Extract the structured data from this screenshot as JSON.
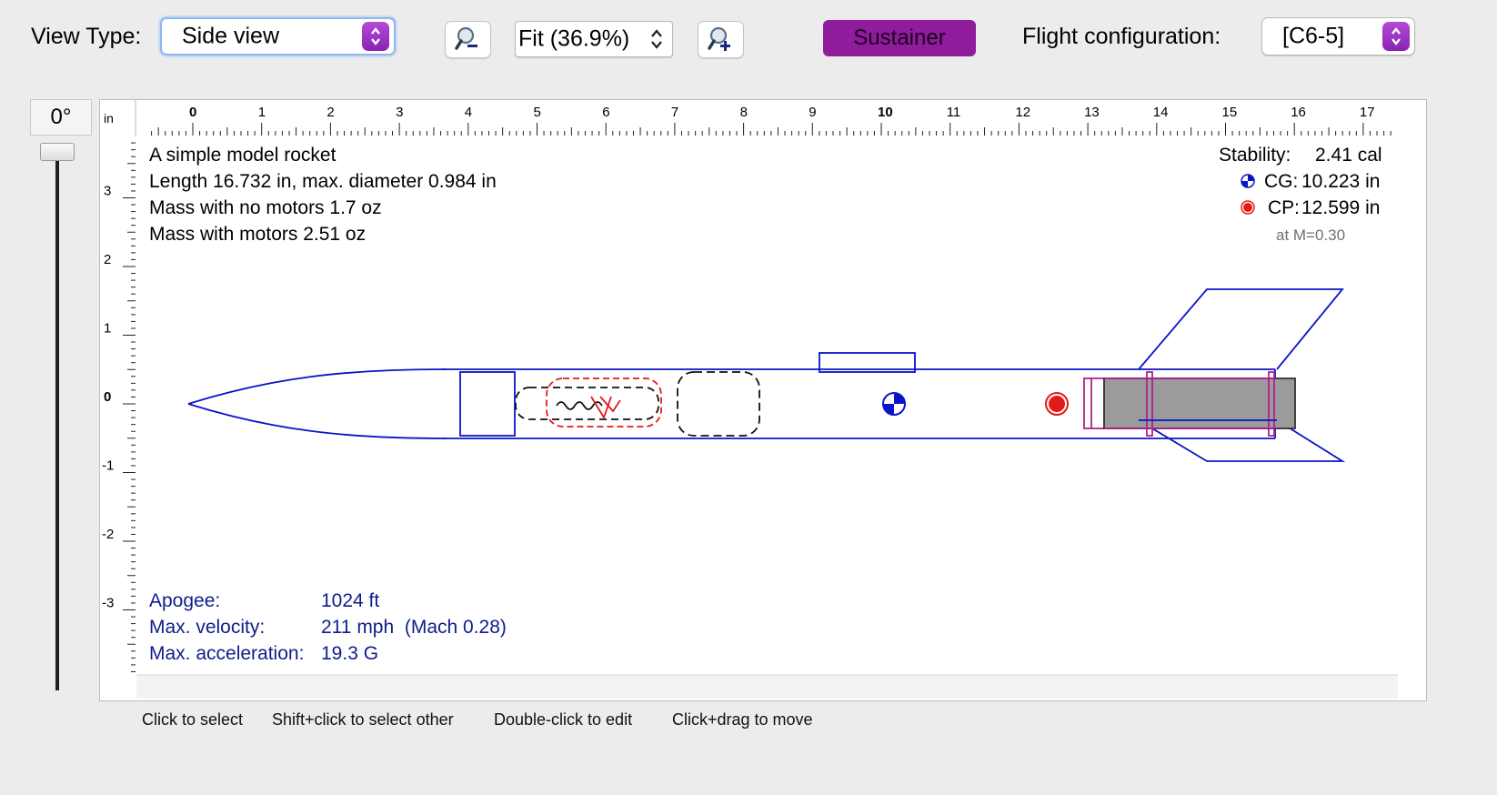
{
  "toolbar": {
    "view_type_label": "View Type:",
    "view_type_value": "Side view",
    "zoom_value": "Fit (36.9%)",
    "stage_button": "Sustainer",
    "flight_config_label": "Flight configuration:",
    "flight_config_value": "[C6-5]"
  },
  "rotation": {
    "angle": "0°"
  },
  "ruler": {
    "unit": "in",
    "h_ticks": [
      "0",
      "1",
      "2",
      "3",
      "4",
      "5",
      "6",
      "7",
      "8",
      "9",
      "10",
      "11",
      "12",
      "13",
      "14",
      "15",
      "16",
      "17"
    ],
    "v_ticks": [
      "3",
      "2",
      "1",
      "0",
      "-1",
      "-2",
      "-3"
    ]
  },
  "design_info": {
    "name": "A simple model rocket",
    "length_line": "Length 16.732 in, max. diameter 0.984 in",
    "mass_no_motor": "Mass with no motors 1.7 oz",
    "mass_with_motor": "Mass with motors 2.51 oz"
  },
  "stability": {
    "label": "Stability:",
    "value": "2.41 cal",
    "cg_label": "CG:",
    "cg_value": "10.223 in",
    "cp_label": "CP:",
    "cp_value": "12.599 in",
    "mach_note": "at M=0.30"
  },
  "flight": {
    "apogee_label": "Apogee:",
    "apogee_value": "1024 ft",
    "velocity_label": "Max. velocity:",
    "velocity_value": "211 mph  (Mach 0.28)",
    "accel_label": "Max. acceleration:",
    "accel_value": "19.3 G"
  },
  "hints": {
    "select": "Click to select",
    "select_other": "Shift+click to select other",
    "edit": "Double-click to edit",
    "move": "Click+drag to move"
  },
  "colors": {
    "structure": "#0a14c8",
    "recovery": "#e41a1a",
    "motor_mount": "#b0208c",
    "motor_fill": "#9b9b9b",
    "stage_button": "#8e1c9c"
  },
  "icons": [
    "zoom-out-icon",
    "zoom-in-icon",
    "stepper-icon",
    "cg-marker-icon",
    "cp-marker-icon"
  ]
}
